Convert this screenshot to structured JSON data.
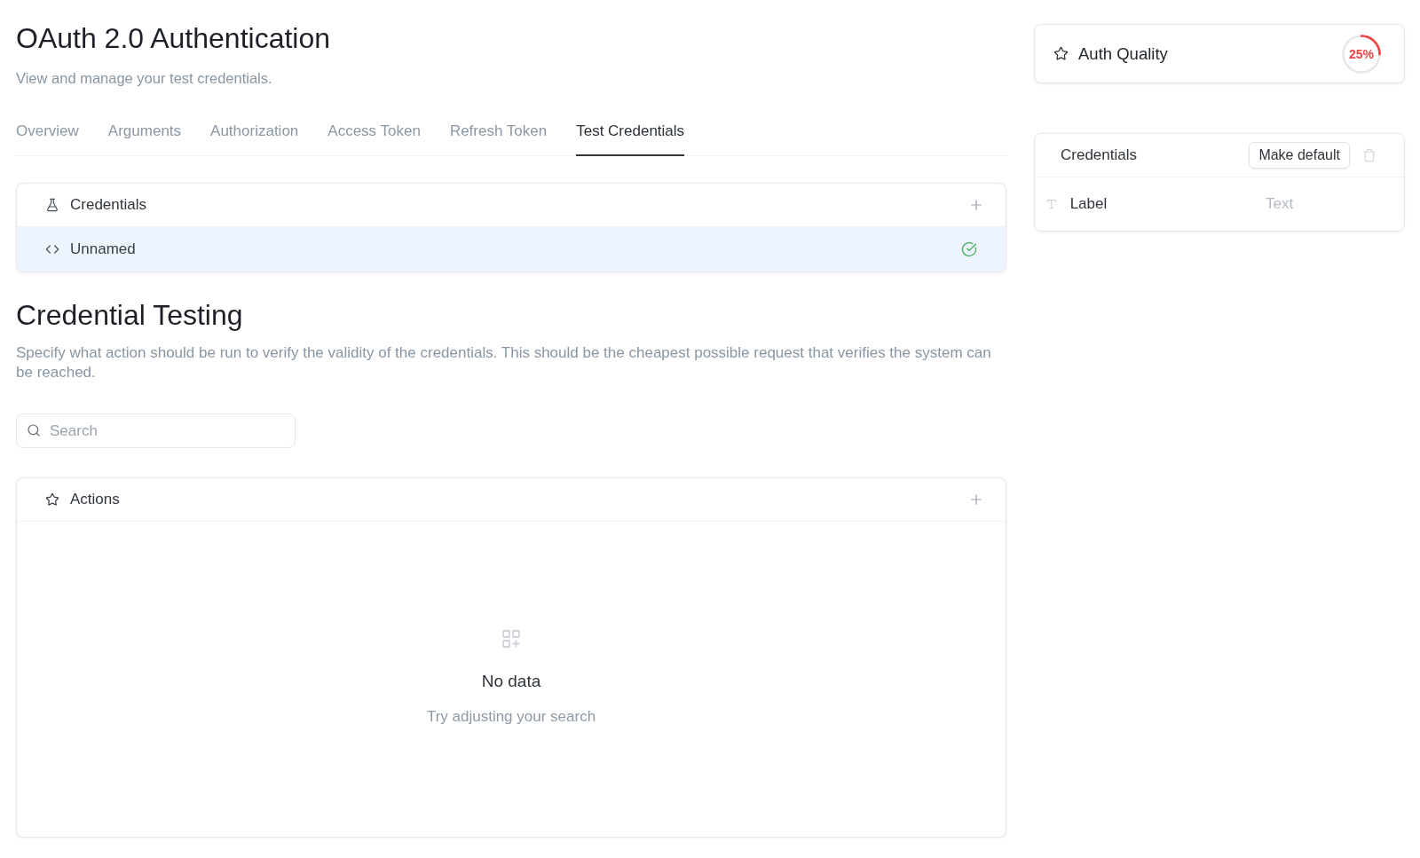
{
  "page": {
    "title": "OAuth 2.0 Authentication",
    "subtitle": "View and manage your test credentials."
  },
  "tabs": [
    {
      "label": "Overview",
      "selected": false
    },
    {
      "label": "Arguments",
      "selected": false
    },
    {
      "label": "Authorization",
      "selected": false
    },
    {
      "label": "Access Token",
      "selected": false
    },
    {
      "label": "Refresh Token",
      "selected": false
    },
    {
      "label": "Test Credentials",
      "selected": true
    }
  ],
  "credentials_panel": {
    "title": "Credentials",
    "items": [
      {
        "name": "Unnamed",
        "selected": true,
        "verified": true
      }
    ]
  },
  "credential_testing": {
    "title": "Credential Testing",
    "description": "Specify what action should be run to verify the validity of the credentials. This should be the cheapest possible request that verifies the system can be reached.",
    "search": {
      "placeholder": "Search"
    },
    "actions_panel": {
      "title": "Actions",
      "empty_state": {
        "title": "No data",
        "message": "Try adjusting your search"
      }
    }
  },
  "auth_quality": {
    "title": "Auth Quality",
    "level": 0.25,
    "reading": "25%"
  },
  "credential_details": {
    "title": "Credentials",
    "make_default_button": "Make default",
    "fields": [
      {
        "label": "Label",
        "placeholder": "Text"
      }
    ]
  }
}
